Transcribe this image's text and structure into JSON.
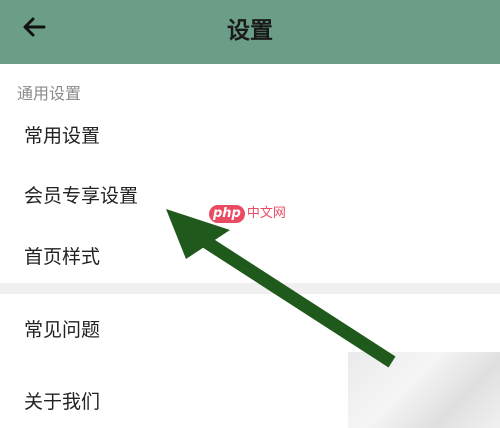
{
  "app_bar": {
    "title": "设置",
    "back_icon": "arrow-left-icon",
    "background_color": "#6a9e86"
  },
  "sections": [
    {
      "header": "通用设置",
      "items": [
        {
          "label": "常用设置"
        },
        {
          "label": "会员专享设置"
        },
        {
          "label": "首页样式"
        }
      ]
    },
    {
      "items": [
        {
          "label": "常见问题"
        },
        {
          "label": "关于我们"
        }
      ]
    }
  ],
  "watermark": {
    "brand": "php",
    "text": "中文网",
    "color": "#e94c62"
  },
  "annotation": {
    "type": "arrow",
    "color": "#1f5a1c",
    "target": "会员专享设置"
  }
}
